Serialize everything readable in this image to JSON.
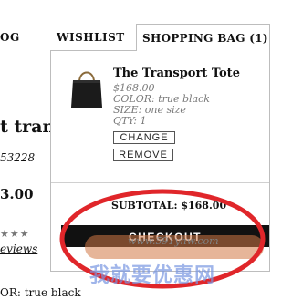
{
  "nav": {
    "partial_item": "OG",
    "wishlist": "WISHLIST",
    "shopping_bag": "SHOPPING BAG (1)"
  },
  "background_page": {
    "title_partial": "t trans",
    "sku_partial": "53228",
    "price_partial": "3.00",
    "stars": "★★★",
    "reviews_partial": "eviews",
    "color_partial": "OR: true black"
  },
  "bag": {
    "item": {
      "name": "The Transport Tote",
      "price": "$168.00",
      "color": "COLOR: true black",
      "size": "SIZE: one size",
      "qty": "QTY: 1",
      "image_icon": "tote-bag-icon"
    },
    "change_label": "CHANGE",
    "remove_label": "REMOVE",
    "subtotal": "SUBTOTAL: $168.00",
    "checkout_label": "CHECKOUT"
  },
  "watermark": {
    "url": "www.591yhw.com",
    "text": "我就要优惠网"
  },
  "colors": {
    "accent_red": "#e0262a",
    "checkout_bg": "#111111",
    "border": "#bdbdbd"
  }
}
